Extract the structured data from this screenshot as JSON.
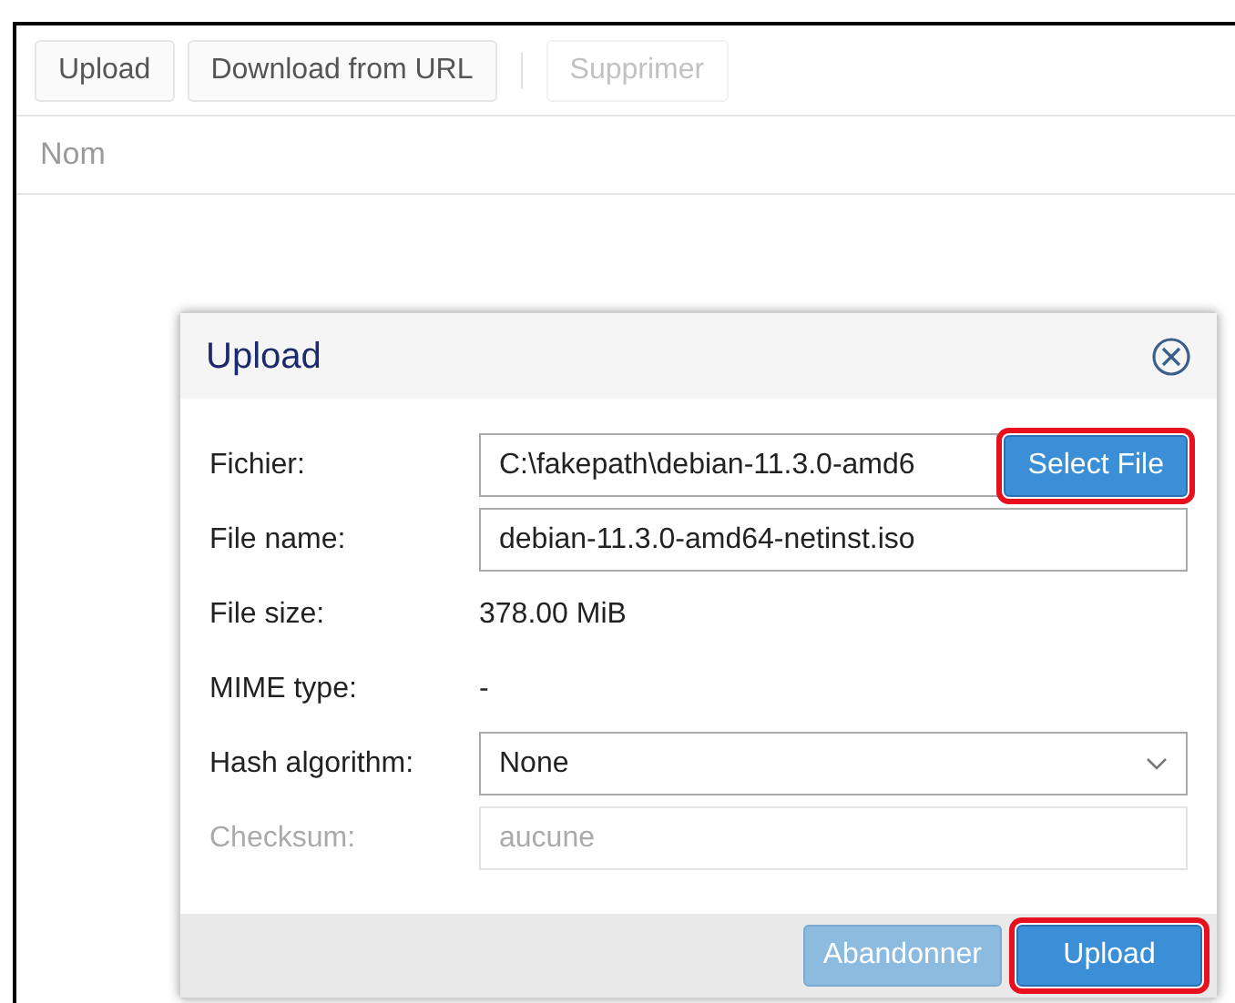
{
  "toolbar": [
    {
      "label": "Upload",
      "disabled": false
    },
    {
      "label": "Download from URL",
      "disabled": false
    },
    {
      "label": "Supprimer",
      "disabled": true
    }
  ],
  "table": {
    "columns": [
      "Nom"
    ]
  },
  "dialog": {
    "title": "Upload",
    "fields": [
      {
        "kind": "file",
        "label": "Fichier:",
        "value": "C:\\fakepath\\debian-11.3.0-amd6",
        "button": {
          "label": "Select File",
          "highlighted": true
        },
        "disabled": false
      },
      {
        "kind": "input",
        "label": "File name:",
        "value": "debian-11.3.0-amd64-netinst.iso",
        "disabled": false
      },
      {
        "kind": "static",
        "label": "File size:",
        "value": "378.00 MiB",
        "disabled": false
      },
      {
        "kind": "static",
        "label": "MIME type:",
        "value": "-",
        "disabled": false
      },
      {
        "kind": "select",
        "label": "Hash algorithm:",
        "value": "None",
        "disabled": false
      },
      {
        "kind": "input",
        "label": "Checksum:",
        "placeholder": "aucune",
        "disabled": true
      }
    ],
    "buttons": [
      {
        "label": "Abandonner",
        "disabled": true,
        "highlighted": false
      },
      {
        "label": "Upload",
        "disabled": false,
        "highlighted": true
      }
    ]
  }
}
